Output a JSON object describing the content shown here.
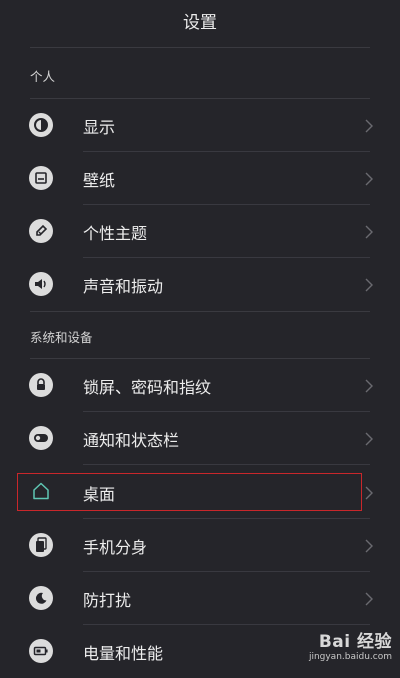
{
  "header": {
    "title": "设置"
  },
  "sections": {
    "personal": "个人",
    "system": "系统和设备"
  },
  "items": [
    {
      "label": "显示",
      "icon": "display-icon"
    },
    {
      "label": "壁纸",
      "icon": "wallpaper-icon"
    },
    {
      "label": "个性主题",
      "icon": "theme-icon"
    },
    {
      "label": "声音和振动",
      "icon": "sound-icon"
    },
    {
      "label": "锁屏、密码和指纹",
      "icon": "lock-icon"
    },
    {
      "label": "通知和状态栏",
      "icon": "notification-icon"
    },
    {
      "label": "桌面",
      "icon": "home-icon"
    },
    {
      "label": "手机分身",
      "icon": "phone-clone-icon"
    },
    {
      "label": "防打扰",
      "icon": "moon-icon"
    },
    {
      "label": "电量和性能",
      "icon": "battery-icon"
    }
  ],
  "colors": {
    "background": "#25252a",
    "highlight_border": "#c9272b",
    "home_icon_accent": "#5fc6b3"
  },
  "watermark": {
    "brand": "Bai 经验",
    "url": "jingyan.baidu.com"
  }
}
